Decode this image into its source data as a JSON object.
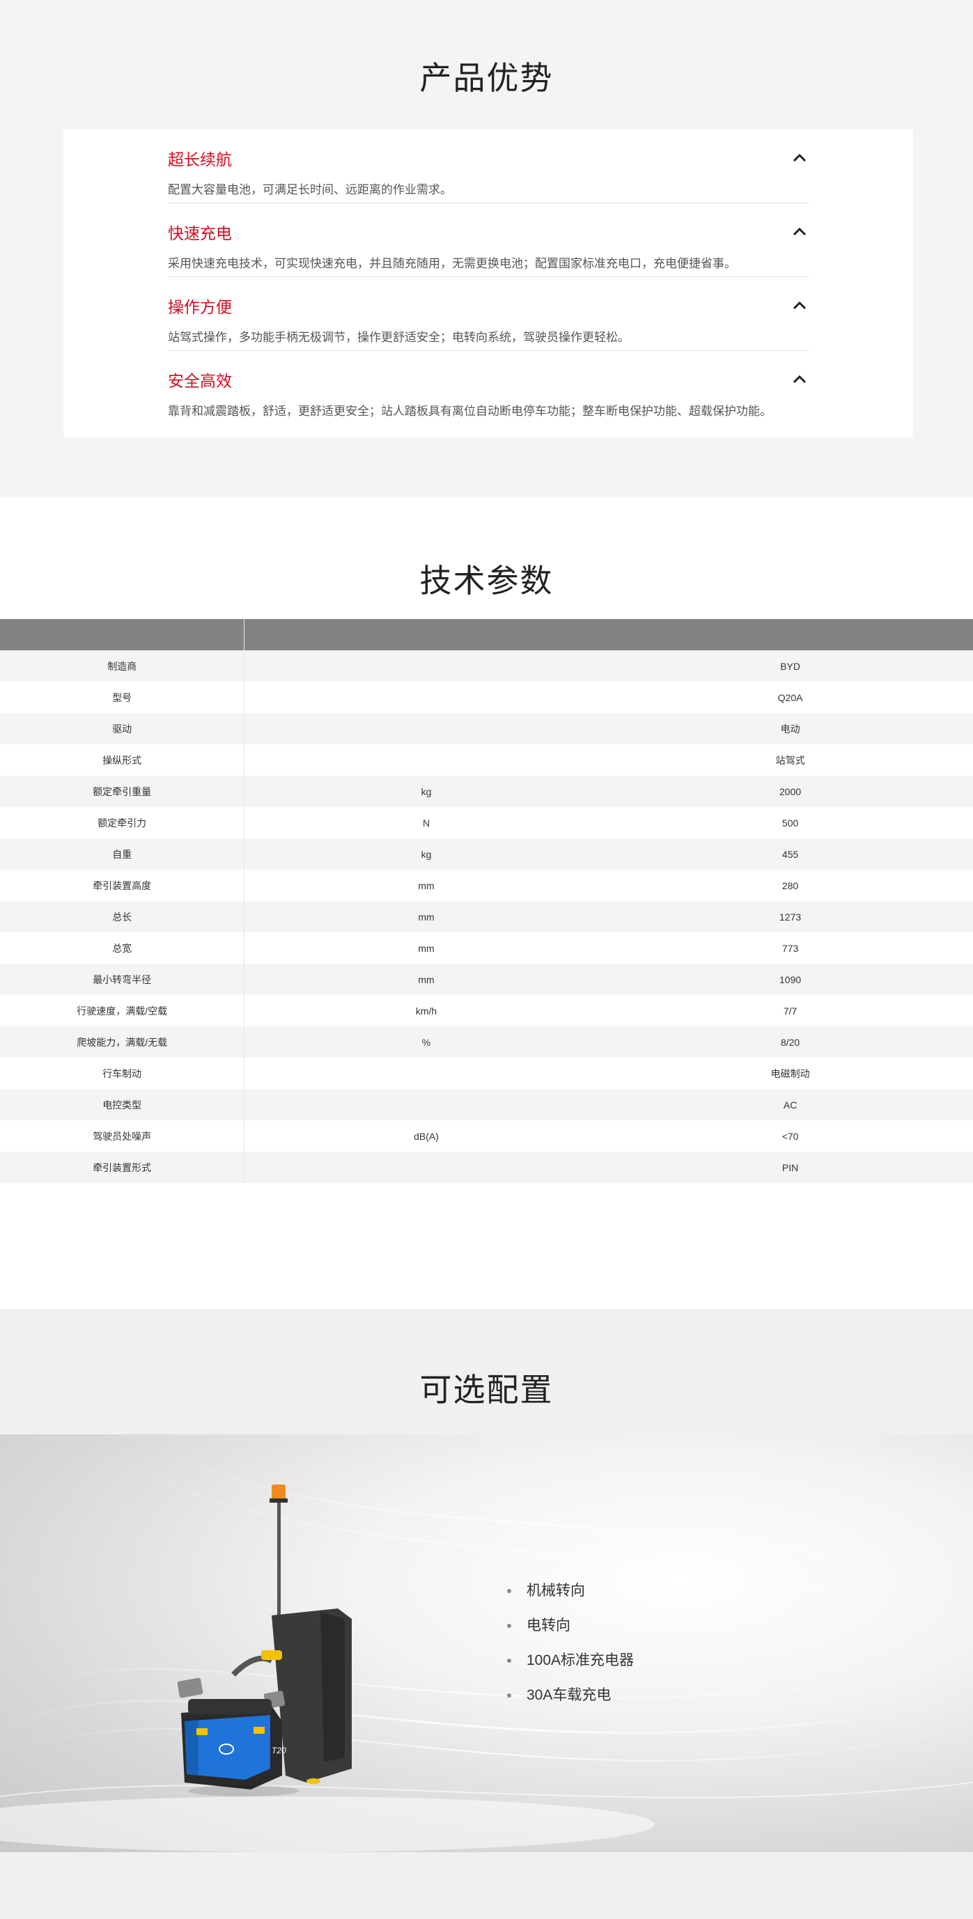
{
  "advantages": {
    "title": "产品优势",
    "items": [
      {
        "heading": "超长续航",
        "desc": "配置大容量电池，可满足长时间、远距离的作业需求。"
      },
      {
        "heading": "快速充电",
        "desc": "采用快速充电技术，可实现快速充电，并且随充随用，无需更换电池；配置国家标准充电口，充电便捷省事。"
      },
      {
        "heading": "操作方便",
        "desc": "站驾式操作，多功能手柄无极调节，操作更舒适安全；电转向系统，驾驶员操作更轻松。"
      },
      {
        "heading": "安全高效",
        "desc": "靠背和减震踏板，舒适，更舒适更安全；站人踏板具有离位自动断电停车功能；整车断电保护功能、超载保护功能。"
      }
    ],
    "toggle_icon": "chevron-up-icon",
    "accent_color": "#d40d22"
  },
  "specs": {
    "title": "技术参数",
    "rows": [
      {
        "name": "制造商",
        "unit": "",
        "value": "BYD"
      },
      {
        "name": "型号",
        "unit": "",
        "value": "Q20A"
      },
      {
        "name": "驱动",
        "unit": "",
        "value": "电动"
      },
      {
        "name": "操纵形式",
        "unit": "",
        "value": "站驾式"
      },
      {
        "name": "额定牵引重量",
        "unit": "kg",
        "value": "2000"
      },
      {
        "name": "额定牵引力",
        "unit": "N",
        "value": "500"
      },
      {
        "name": "自重",
        "unit": "kg",
        "value": "455"
      },
      {
        "name": "牵引装置高度",
        "unit": "mm",
        "value": "280"
      },
      {
        "name": "总长",
        "unit": "mm",
        "value": "1273"
      },
      {
        "name": "总宽",
        "unit": "mm",
        "value": "773"
      },
      {
        "name": "最小转弯半径",
        "unit": "mm",
        "value": "1090"
      },
      {
        "name": "行驶速度，满载/空载",
        "unit": "km/h",
        "value": "7/7"
      },
      {
        "name": "爬坡能力，满载/无载",
        "unit": "%",
        "value": "8/20"
      },
      {
        "name": "行车制动",
        "unit": "",
        "value": "电磁制动"
      },
      {
        "name": "电控类型",
        "unit": "",
        "value": "AC"
      },
      {
        "name": "驾驶员处噪声",
        "unit": "dB(A)",
        "value": "<70"
      },
      {
        "name": "牵引装置形式",
        "unit": "",
        "value": "PIN"
      }
    ]
  },
  "options": {
    "title": "可选配置",
    "items": [
      "机械转向",
      "电转向",
      "100A标准充电器",
      "30A车载充电"
    ],
    "truck_image": "electric-tow-tractor-image",
    "truck_model_label": "T20"
  }
}
